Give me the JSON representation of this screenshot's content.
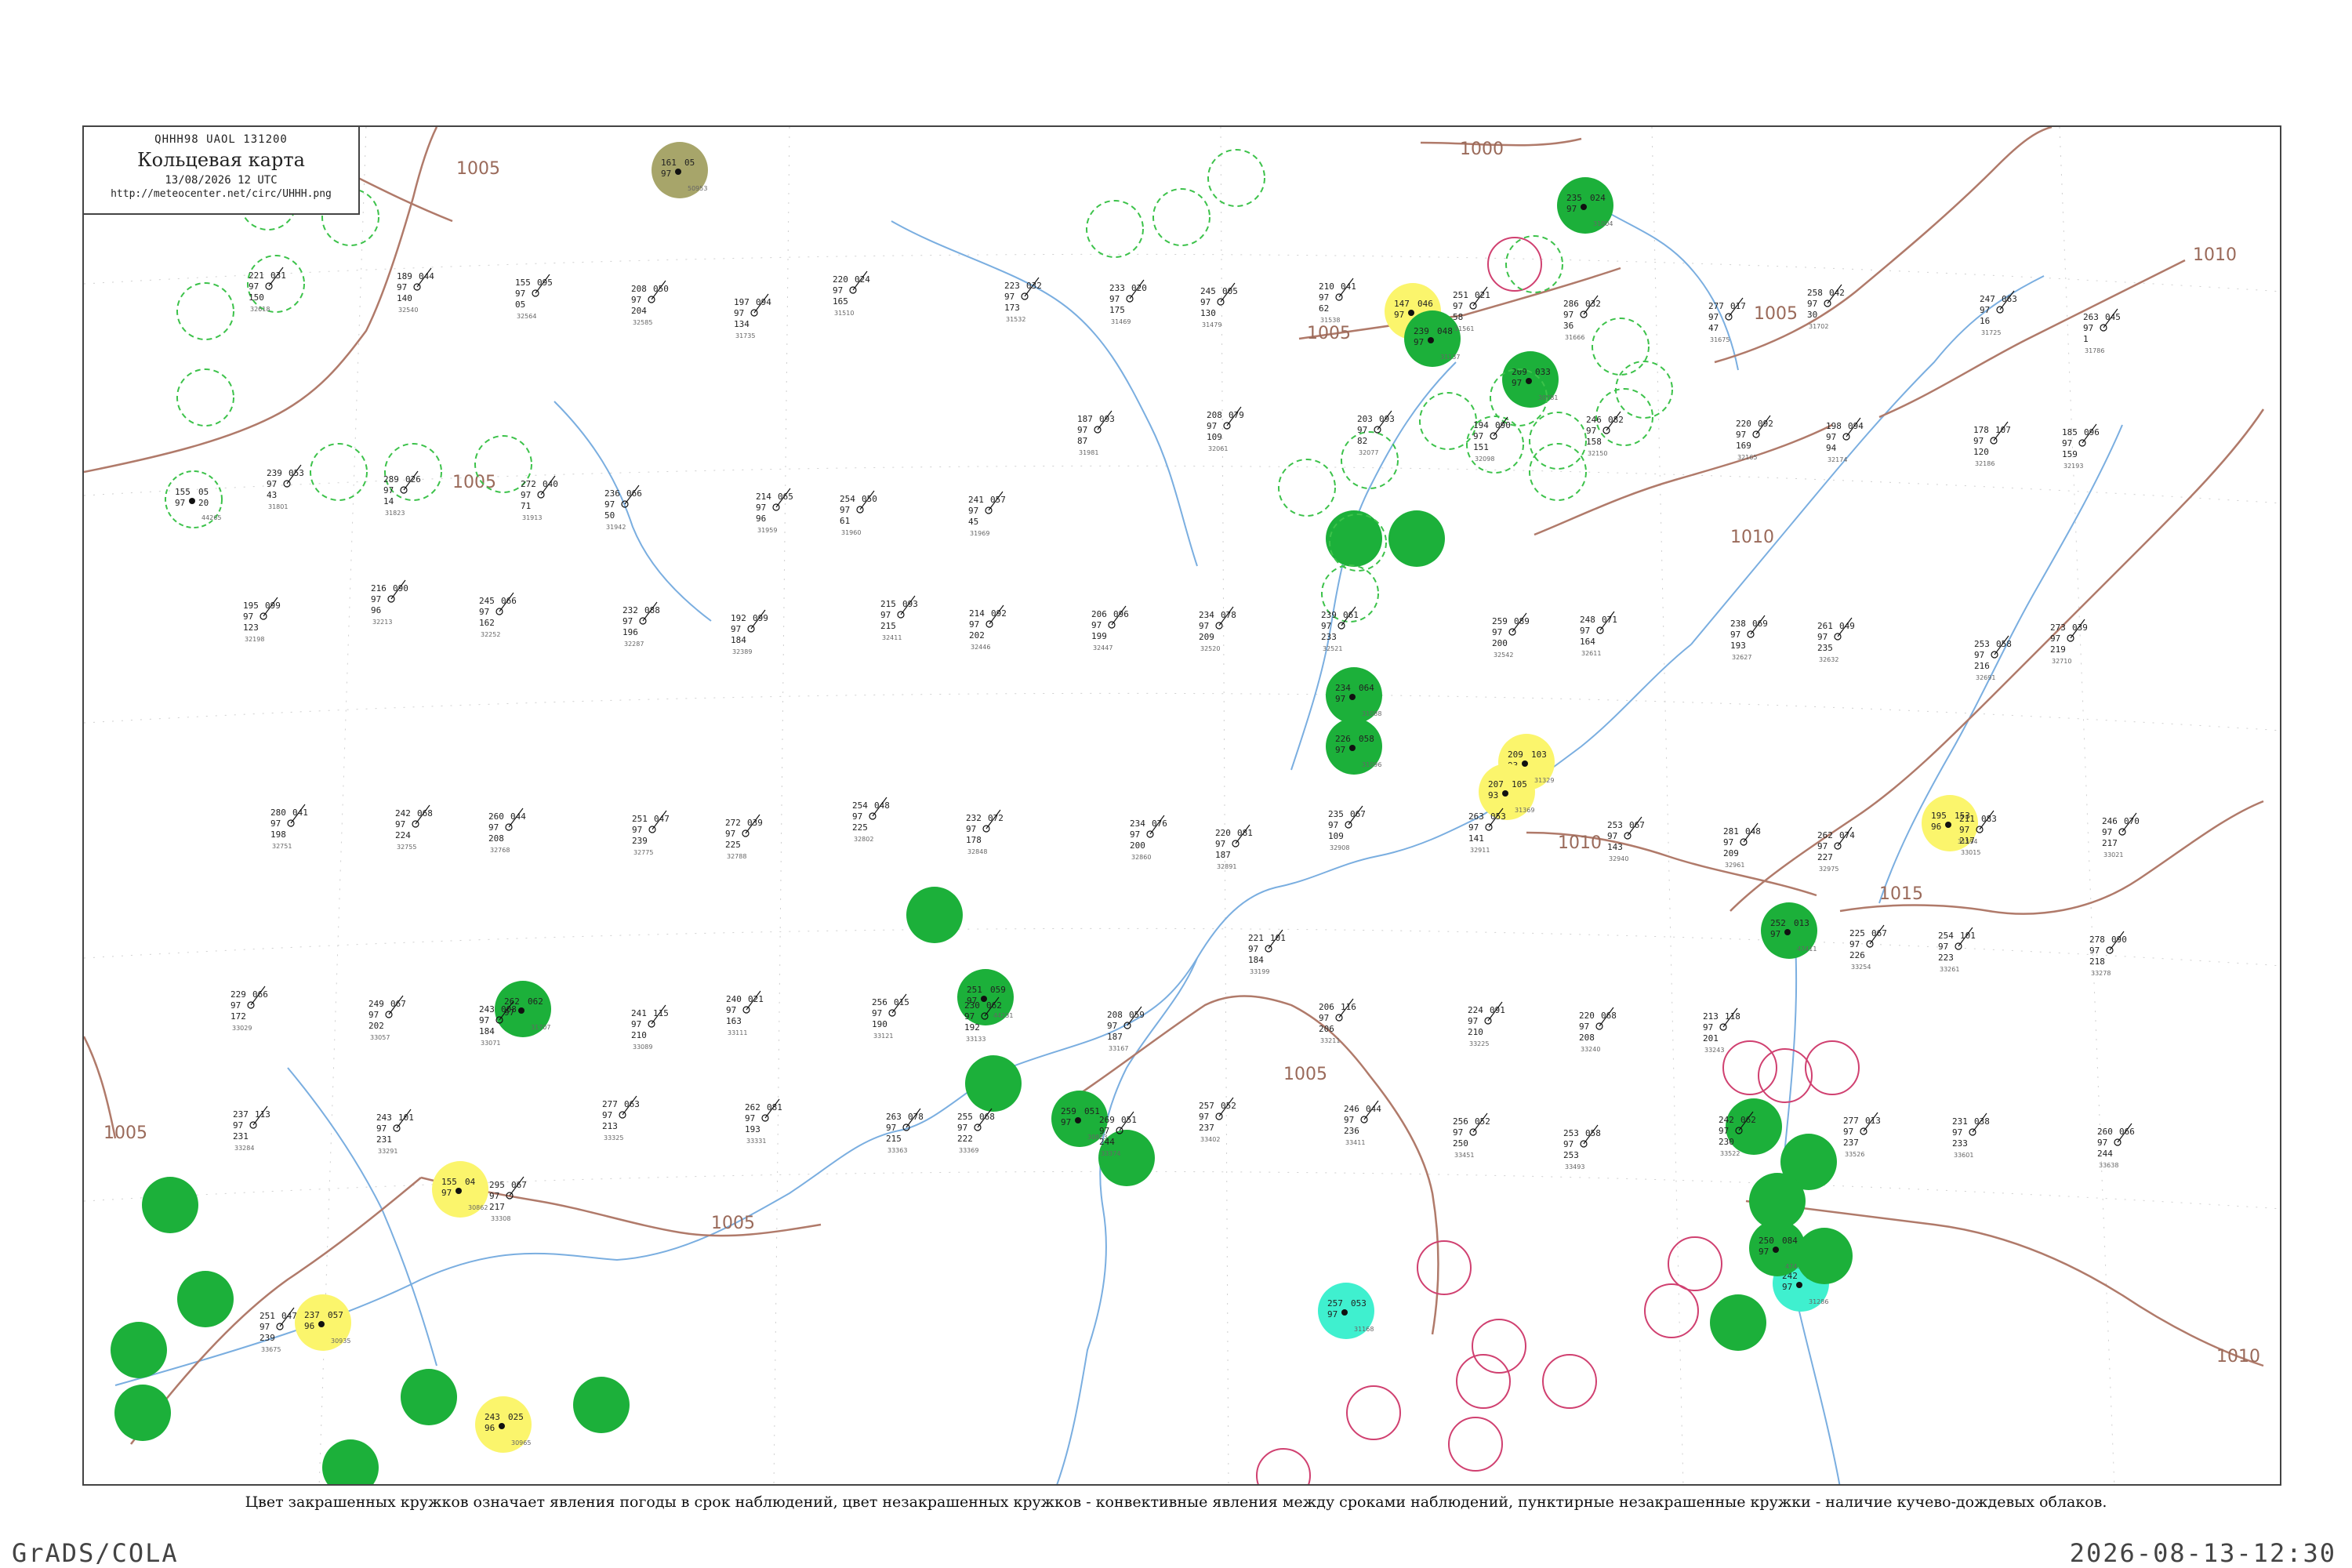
{
  "header": {
    "code": "QHHH98  UAOL  131200",
    "title": "Кольцевая карта",
    "date": "13/08/2026 12 UTC",
    "url": "http://meteocenter.net/circ/UHHH.png"
  },
  "caption": "Цвет закрашенных кружков означает явления погоды в срок наблюдений, цвет незакрашенных кружков - конвективные явления между сроками наблюдений, пунктирные незакрашенные кружки - наличие кучево-дождевых облаков.",
  "footer": {
    "left": "GrADS/COLA",
    "right": "2026-08-13-12:30"
  },
  "colors": {
    "isobar": "#b07a6a",
    "river": "#7aaee0",
    "filled_green": "#1cb03a",
    "filled_yellow": "#fbf56c",
    "filled_cyan": "#3ff0cf",
    "filled_olive": "#a7a56a",
    "dashed_green": "#3cc24a",
    "thunder_red": "#d04070"
  },
  "isobar_labels": [
    "1000",
    "1005",
    "1005",
    "1005",
    "1005",
    "1005",
    "1010",
    "1010",
    "1010",
    "1015",
    "1005",
    "1005",
    "1010"
  ],
  "stations": [
    {
      "id": "44265",
      "p": "155",
      "t": "97",
      "tr": "05",
      "mark": "dashed-green",
      "ph": "20"
    },
    {
      "id": "50953",
      "p": "161",
      "t": "97",
      "tr": "05",
      "mark": "olive"
    },
    {
      "id": "31300",
      "p": "147",
      "t": "97",
      "tr": "046",
      "mark": "yellow"
    },
    {
      "id": "31329",
      "p": "209",
      "t": "93",
      "tr": "103",
      "mark": "yellow"
    },
    {
      "id": "31369",
      "p": "207",
      "t": "93",
      "tr": "105",
      "mark": "yellow"
    },
    {
      "id": "31594",
      "p": "195",
      "t": "96",
      "tr": "153",
      "mark": "yellow"
    },
    {
      "id": "30862",
      "p": "155",
      "t": "97",
      "tr": "04",
      "mark": "yellow"
    },
    {
      "id": "30935",
      "p": "237",
      "t": "96",
      "tr": "057",
      "mark": "yellow"
    },
    {
      "id": "30965",
      "p": "243",
      "t": "96",
      "tr": "025",
      "mark": "yellow"
    },
    {
      "id": "31004",
      "p": "235",
      "t": "97",
      "tr": "024",
      "mark": "green"
    },
    {
      "id": "31088",
      "p": "234",
      "t": "97",
      "tr": "064",
      "mark": "green"
    },
    {
      "id": "31096",
      "p": "226",
      "t": "97",
      "tr": "058",
      "mark": "green"
    },
    {
      "id": "31137",
      "p": "239",
      "t": "97",
      "tr": "048",
      "mark": "green"
    },
    {
      "id": "31168",
      "p": "257",
      "t": "97",
      "tr": "053",
      "mark": "cyan"
    },
    {
      "id": "31286",
      "p": "242",
      "t": "97",
      "tr": "082",
      "mark": "cyan"
    },
    {
      "id": "44231",
      "p": "251",
      "t": "97",
      "tr": "059",
      "mark": "green"
    },
    {
      "id": "30823",
      "p": "259",
      "t": "97",
      "tr": "051",
      "mark": "green"
    },
    {
      "id": "31707",
      "p": "262",
      "t": "97",
      "tr": "062",
      "mark": "green"
    },
    {
      "id": "47411",
      "p": "252",
      "t": "97",
      "tr": "013",
      "mark": "green"
    },
    {
      "id": "47434",
      "p": "250",
      "t": "97",
      "tr": "084",
      "mark": "green"
    },
    {
      "id": "30781",
      "p": "209",
      "t": "97",
      "tr": "033",
      "mark": "green"
    }
  ],
  "station_readouts": [
    {
      "id": "32618",
      "p": "221",
      "t": "97",
      "tr": "031",
      "ppp": "150"
    },
    {
      "id": "32540",
      "p": "189",
      "t": "97",
      "tr": "044",
      "ppp": "140"
    },
    {
      "id": "32564",
      "p": "155",
      "t": "97",
      "tr": "095",
      "ppp": "05"
    },
    {
      "id": "32585",
      "p": "208",
      "t": "97",
      "tr": "050",
      "ppp": "204"
    },
    {
      "id": "31735",
      "p": "197",
      "t": "97",
      "tr": "094",
      "ppp": "134"
    },
    {
      "id": "31510",
      "p": "220",
      "t": "97",
      "tr": "024",
      "ppp": "165"
    },
    {
      "id": "31532",
      "p": "223",
      "t": "97",
      "tr": "032",
      "ppp": "173"
    },
    {
      "id": "31469",
      "p": "233",
      "t": "97",
      "tr": "020",
      "ppp": "175"
    },
    {
      "id": "31479",
      "p": "245",
      "t": "97",
      "tr": "005",
      "ppp": "130"
    },
    {
      "id": "31538",
      "p": "210",
      "t": "97",
      "tr": "041",
      "ppp": "62"
    },
    {
      "id": "31561",
      "p": "251",
      "t": "97",
      "tr": "021",
      "ppp": "58"
    },
    {
      "id": "31666",
      "p": "286",
      "t": "97",
      "tr": "032",
      "ppp": "36"
    },
    {
      "id": "31675",
      "p": "277",
      "t": "97",
      "tr": "017",
      "ppp": "47"
    },
    {
      "id": "31702",
      "p": "258",
      "t": "97",
      "tr": "042",
      "ppp": "30"
    },
    {
      "id": "31725",
      "p": "247",
      "t": "97",
      "tr": "063",
      "ppp": "16"
    },
    {
      "id": "31786",
      "p": "263",
      "t": "97",
      "tr": "045",
      "ppp": "1"
    },
    {
      "id": "31801",
      "p": "239",
      "t": "97",
      "tr": "053",
      "ppp": "43"
    },
    {
      "id": "31823",
      "p": "289",
      "t": "97",
      "tr": "026",
      "ppp": "14"
    },
    {
      "id": "31913",
      "p": "272",
      "t": "97",
      "tr": "040",
      "ppp": "71"
    },
    {
      "id": "31942",
      "p": "236",
      "t": "97",
      "tr": "066",
      "ppp": "50"
    },
    {
      "id": "31959",
      "p": "214",
      "t": "97",
      "tr": "065",
      "ppp": "96"
    },
    {
      "id": "31960",
      "p": "254",
      "t": "97",
      "tr": "050",
      "ppp": "61"
    },
    {
      "id": "31969",
      "p": "241",
      "t": "97",
      "tr": "057",
      "ppp": "45"
    },
    {
      "id": "31981",
      "p": "187",
      "t": "97",
      "tr": "093",
      "ppp": "87"
    },
    {
      "id": "32061",
      "p": "208",
      "t": "97",
      "tr": "079",
      "ppp": "109"
    },
    {
      "id": "32077",
      "p": "203",
      "t": "97",
      "tr": "093",
      "ppp": "82"
    },
    {
      "id": "32098",
      "p": "194",
      "t": "97",
      "tr": "090",
      "ppp": "151"
    },
    {
      "id": "32150",
      "p": "246",
      "t": "97",
      "tr": "082",
      "ppp": "158"
    },
    {
      "id": "32165",
      "p": "220",
      "t": "97",
      "tr": "092",
      "ppp": "169"
    },
    {
      "id": "32174",
      "p": "198",
      "t": "97",
      "tr": "094",
      "ppp": "94"
    },
    {
      "id": "32186",
      "p": "178",
      "t": "97",
      "tr": "107",
      "ppp": "120"
    },
    {
      "id": "32193",
      "p": "185",
      "t": "97",
      "tr": "096",
      "ppp": "159"
    },
    {
      "id": "32198",
      "p": "195",
      "t": "97",
      "tr": "099",
      "ppp": "123"
    },
    {
      "id": "32213",
      "p": "216",
      "t": "97",
      "tr": "090",
      "ppp": "96"
    },
    {
      "id": "32252",
      "p": "245",
      "t": "97",
      "tr": "066",
      "ppp": "162"
    },
    {
      "id": "32287",
      "p": "232",
      "t": "97",
      "tr": "088",
      "ppp": "196"
    },
    {
      "id": "32389",
      "p": "192",
      "t": "97",
      "tr": "099",
      "ppp": "184"
    },
    {
      "id": "32411",
      "p": "215",
      "t": "97",
      "tr": "093",
      "ppp": "215"
    },
    {
      "id": "32446",
      "p": "214",
      "t": "97",
      "tr": "092",
      "ppp": "202"
    },
    {
      "id": "32447",
      "p": "206",
      "t": "97",
      "tr": "096",
      "ppp": "199"
    },
    {
      "id": "32520",
      "p": "234",
      "t": "97",
      "tr": "078",
      "ppp": "209"
    },
    {
      "id": "32521",
      "p": "239",
      "t": "97",
      "tr": "061",
      "ppp": "233"
    },
    {
      "id": "32542",
      "p": "259",
      "t": "97",
      "tr": "089",
      "ppp": "200"
    },
    {
      "id": "32611",
      "p": "248",
      "t": "97",
      "tr": "071",
      "ppp": "164"
    },
    {
      "id": "32627",
      "p": "238",
      "t": "97",
      "tr": "069",
      "ppp": "193"
    },
    {
      "id": "32632",
      "p": "261",
      "t": "97",
      "tr": "049",
      "ppp": "235"
    },
    {
      "id": "32691",
      "p": "253",
      "t": "97",
      "tr": "058",
      "ppp": "216"
    },
    {
      "id": "32710",
      "p": "273",
      "t": "97",
      "tr": "039",
      "ppp": "219"
    },
    {
      "id": "32751",
      "p": "280",
      "t": "97",
      "tr": "041",
      "ppp": "198"
    },
    {
      "id": "32755",
      "p": "242",
      "t": "97",
      "tr": "068",
      "ppp": "224"
    },
    {
      "id": "32768",
      "p": "260",
      "t": "97",
      "tr": "044",
      "ppp": "208"
    },
    {
      "id": "32775",
      "p": "251",
      "t": "97",
      "tr": "047",
      "ppp": "239"
    },
    {
      "id": "32788",
      "p": "272",
      "t": "97",
      "tr": "039",
      "ppp": "225"
    },
    {
      "id": "32802",
      "p": "254",
      "t": "97",
      "tr": "048",
      "ppp": "225"
    },
    {
      "id": "32848",
      "p": "232",
      "t": "97",
      "tr": "072",
      "ppp": "178"
    },
    {
      "id": "32860",
      "p": "234",
      "t": "97",
      "tr": "076",
      "ppp": "200"
    },
    {
      "id": "32891",
      "p": "220",
      "t": "97",
      "tr": "081",
      "ppp": "187"
    },
    {
      "id": "32908",
      "p": "235",
      "t": "97",
      "tr": "067",
      "ppp": "109"
    },
    {
      "id": "32911",
      "p": "263",
      "t": "97",
      "tr": "053",
      "ppp": "141"
    },
    {
      "id": "32940",
      "p": "253",
      "t": "97",
      "tr": "067",
      "ppp": "143"
    },
    {
      "id": "32961",
      "p": "281",
      "t": "97",
      "tr": "048",
      "ppp": "209"
    },
    {
      "id": "32975",
      "p": "262",
      "t": "97",
      "tr": "074",
      "ppp": "227"
    },
    {
      "id": "33015",
      "p": "211",
      "t": "97",
      "tr": "083",
      "ppp": "217"
    },
    {
      "id": "33021",
      "p": "246",
      "t": "97",
      "tr": "070",
      "ppp": "217"
    },
    {
      "id": "33029",
      "p": "229",
      "t": "97",
      "tr": "066",
      "ppp": "172"
    },
    {
      "id": "33057",
      "p": "249",
      "t": "97",
      "tr": "067",
      "ppp": "202"
    },
    {
      "id": "33071",
      "p": "243",
      "t": "97",
      "tr": "008",
      "ppp": "184"
    },
    {
      "id": "33089",
      "p": "241",
      "t": "97",
      "tr": "115",
      "ppp": "210"
    },
    {
      "id": "33111",
      "p": "240",
      "t": "97",
      "tr": "021",
      "ppp": "163"
    },
    {
      "id": "33121",
      "p": "256",
      "t": "97",
      "tr": "015",
      "ppp": "190"
    },
    {
      "id": "33133",
      "p": "230",
      "t": "97",
      "tr": "062",
      "ppp": "192"
    },
    {
      "id": "33167",
      "p": "208",
      "t": "97",
      "tr": "059",
      "ppp": "187"
    },
    {
      "id": "33199",
      "p": "221",
      "t": "97",
      "tr": "101",
      "ppp": "184"
    },
    {
      "id": "33211",
      "p": "206",
      "t": "97",
      "tr": "116",
      "ppp": "206"
    },
    {
      "id": "33225",
      "p": "224",
      "t": "97",
      "tr": "091",
      "ppp": "210"
    },
    {
      "id": "33240",
      "p": "220",
      "t": "97",
      "tr": "068",
      "ppp": "208"
    },
    {
      "id": "33243",
      "p": "213",
      "t": "97",
      "tr": "118",
      "ppp": "201"
    },
    {
      "id": "33254",
      "p": "225",
      "t": "97",
      "tr": "067",
      "ppp": "226"
    },
    {
      "id": "33261",
      "p": "254",
      "t": "97",
      "tr": "101",
      "ppp": "223"
    },
    {
      "id": "33278",
      "p": "278",
      "t": "97",
      "tr": "090",
      "ppp": "218"
    },
    {
      "id": "33284",
      "p": "237",
      "t": "97",
      "tr": "113",
      "ppp": "231"
    },
    {
      "id": "33291",
      "p": "243",
      "t": "97",
      "tr": "101",
      "ppp": "231"
    },
    {
      "id": "33308",
      "p": "295",
      "t": "97",
      "tr": "067",
      "ppp": "217"
    },
    {
      "id": "33325",
      "p": "277",
      "t": "97",
      "tr": "063",
      "ppp": "213"
    },
    {
      "id": "33331",
      "p": "262",
      "t": "97",
      "tr": "081",
      "ppp": "193"
    },
    {
      "id": "33363",
      "p": "263",
      "t": "97",
      "tr": "078",
      "ppp": "215"
    },
    {
      "id": "33369",
      "p": "255",
      "t": "97",
      "tr": "068",
      "ppp": "222"
    },
    {
      "id": "33374",
      "p": "269",
      "t": "97",
      "tr": "051",
      "ppp": "244"
    },
    {
      "id": "33402",
      "p": "257",
      "t": "97",
      "tr": "052",
      "ppp": "237"
    },
    {
      "id": "33411",
      "p": "246",
      "t": "97",
      "tr": "044",
      "ppp": "236"
    },
    {
      "id": "33451",
      "p": "256",
      "t": "97",
      "tr": "052",
      "ppp": "250"
    },
    {
      "id": "33493",
      "p": "253",
      "t": "97",
      "tr": "058",
      "ppp": "253"
    },
    {
      "id": "33522",
      "p": "242",
      "t": "97",
      "tr": "062",
      "ppp": "230"
    },
    {
      "id": "33526",
      "p": "277",
      "t": "97",
      "tr": "013",
      "ppp": "237"
    },
    {
      "id": "33601",
      "p": "231",
      "t": "97",
      "tr": "038",
      "ppp": "233"
    },
    {
      "id": "33638",
      "p": "260",
      "t": "97",
      "tr": "066",
      "ppp": "244"
    },
    {
      "id": "33675",
      "p": "251",
      "t": "97",
      "tr": "047",
      "ppp": "239"
    }
  ]
}
